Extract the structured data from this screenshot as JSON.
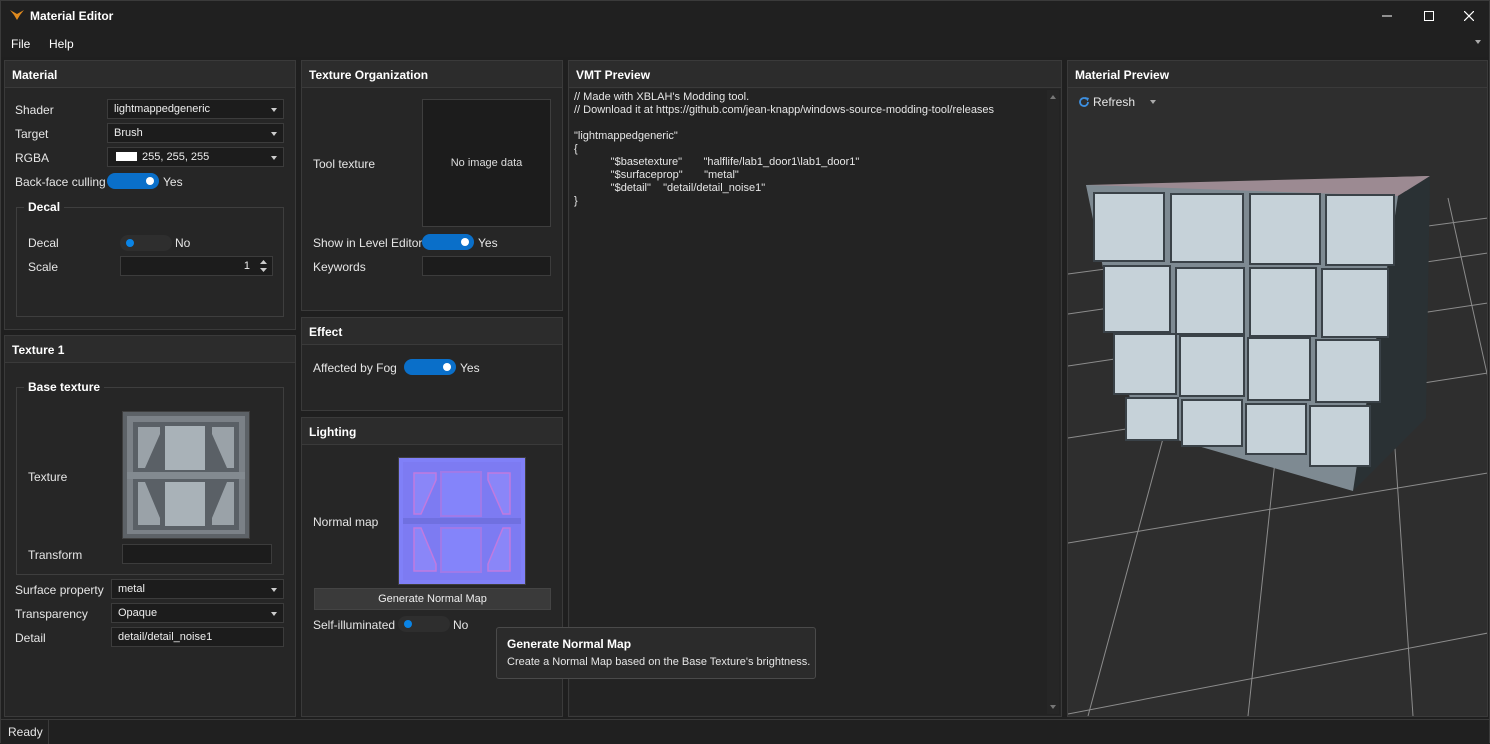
{
  "window": {
    "title": "Material Editor"
  },
  "menu": {
    "file": "File",
    "help": "Help"
  },
  "material": {
    "title": "Material",
    "shader_label": "Shader",
    "shader_value": "lightmappedgeneric",
    "target_label": "Target",
    "target_value": "Brush",
    "rgba_label": "RGBA",
    "rgba_value": "255, 255, 255",
    "rgba_swatch": "#ffffff",
    "backface_label": "Back-face culling",
    "backface_value": "Yes",
    "decal_group": "Decal",
    "decal_label": "Decal",
    "decal_value": "No",
    "scale_label": "Scale",
    "scale_value": "1"
  },
  "texture1": {
    "title": "Texture 1",
    "base_group": "Base texture",
    "texture_label": "Texture",
    "transform_label": "Transform",
    "surface_label": "Surface property",
    "surface_value": "metal",
    "transparency_label": "Transparency",
    "transparency_value": "Opaque",
    "detail_label": "Detail",
    "detail_value": "detail/detail_noise1"
  },
  "texture_org": {
    "title": "Texture Organization",
    "tool_texture_label": "Tool texture",
    "no_image": "No image data",
    "show_label": "Show in Level Editor",
    "show_value": "Yes",
    "keywords_label": "Keywords"
  },
  "effect": {
    "title": "Effect",
    "fog_label": "Affected by Fog",
    "fog_value": "Yes"
  },
  "lighting": {
    "title": "Lighting",
    "normal_label": "Normal map",
    "generate_button": "Generate Normal Map",
    "self_label": "Self-illuminated",
    "self_value": "No"
  },
  "tooltip": {
    "title": "Generate Normal Map",
    "body": "Create a Normal Map based on the Base Texture's brightness."
  },
  "vmt": {
    "title": "VMT Preview",
    "code": "// Made with XBLAH's Modding tool.\n// Download it at https://github.com/jean-knapp/windows-source-modding-tool/releases\n\n\"lightmappedgeneric\"\n{\n            \"$basetexture\"       \"halflife/lab1_door1\\lab1_door1\"\n            \"$surfaceprop\"       \"metal\"\n            \"$detail\"    \"detail/detail_noise1\"\n}"
  },
  "preview": {
    "title": "Material Preview",
    "refresh": "Refresh"
  },
  "status": {
    "text": "Ready"
  },
  "colors": {
    "accent": "#0a6fc9",
    "bg": "#262626"
  }
}
